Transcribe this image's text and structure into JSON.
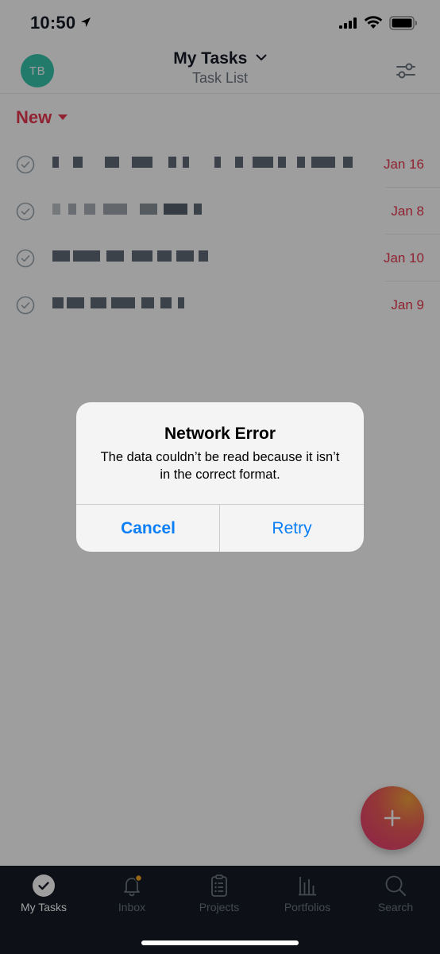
{
  "status_bar": {
    "time": "10:50"
  },
  "header": {
    "avatar_initials": "TB",
    "title": "My Tasks",
    "subtitle": "Task List"
  },
  "section": {
    "label": "New"
  },
  "tasks": [
    {
      "name": "",
      "due": "Jan 16"
    },
    {
      "name": "",
      "due": "Jan 8"
    },
    {
      "name": "",
      "due": "Jan 10"
    },
    {
      "name": "",
      "due": "Jan 9"
    }
  ],
  "alert": {
    "title": "Network Error",
    "message": "The data couldn’t be read because it isn’t in the correct format.",
    "cancel_label": "Cancel",
    "retry_label": "Retry"
  },
  "tab_bar": {
    "tabs": [
      {
        "label": "My Tasks",
        "icon": "check-circle-icon",
        "active": true
      },
      {
        "label": "Inbox",
        "icon": "bell-icon",
        "active": false
      },
      {
        "label": "Projects",
        "icon": "clipboard-icon",
        "active": false
      },
      {
        "label": "Portfolios",
        "icon": "bar-chart-icon",
        "active": false
      },
      {
        "label": "Search",
        "icon": "search-icon",
        "active": false
      }
    ]
  },
  "colors": {
    "accent_red": "#e8384f",
    "avatar_green": "#37c5ab",
    "alert_blue": "#0a7ff5",
    "tab_bar_bg": "#151b26",
    "inbox_badge": "#f5a623"
  }
}
